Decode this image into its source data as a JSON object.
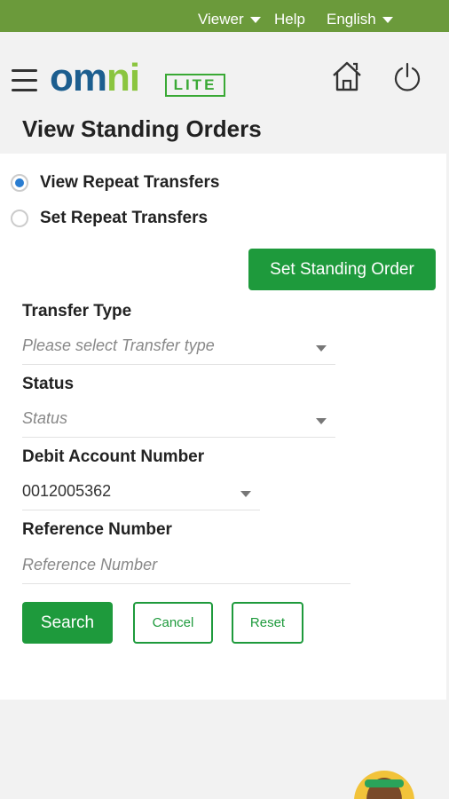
{
  "topbar": {
    "viewer": "Viewer",
    "help": "Help",
    "language": "English"
  },
  "header": {
    "logo_main": "omni",
    "logo_sub": "LITE",
    "home_icon": "home-icon",
    "power_icon": "power-icon"
  },
  "page": {
    "title": "View Standing Orders"
  },
  "mode": {
    "options": [
      {
        "label": "View Repeat Transfers",
        "checked": true
      },
      {
        "label": "Set Repeat Transfers",
        "checked": false
      }
    ]
  },
  "actions": {
    "set_standing_order": "Set Standing Order",
    "search": "Search",
    "cancel": "Cancel",
    "reset": "Reset"
  },
  "form": {
    "transfer_type": {
      "label": "Transfer Type",
      "placeholder": "Please select Transfer type"
    },
    "status": {
      "label": "Status",
      "placeholder": "Status"
    },
    "debit_account": {
      "label": "Debit Account Number",
      "value": "0012005362"
    },
    "reference": {
      "label": "Reference Number",
      "placeholder": "Reference Number"
    }
  },
  "colors": {
    "topbar": "#6b9a3b",
    "brand_green": "#1e9a3c",
    "logo_blue": "#1c5e8f",
    "logo_green": "#8bc53f",
    "radio_blue": "#2a7dd1"
  }
}
